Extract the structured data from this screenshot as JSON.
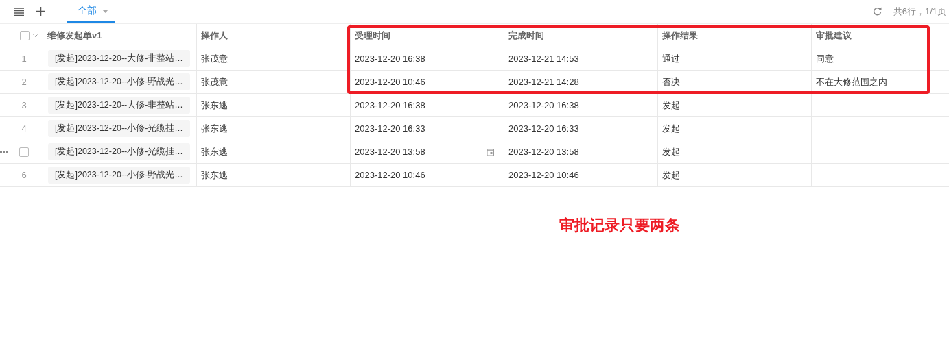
{
  "toolbar": {
    "tabs": [
      {
        "label": "全部",
        "selected": true
      }
    ],
    "summary": "共6行，1/1页"
  },
  "table": {
    "select_all_checked": false,
    "columns": [
      "维修发起单v1",
      "操作人",
      "受理时间",
      "完成时间",
      "操作结果",
      "审批建议"
    ],
    "rows": [
      {
        "index": "1",
        "hovered": false,
        "cells": [
          "[发起]2023-12-20--大修-非整站…",
          "张茂意",
          "2023-12-20 16:38",
          "2023-12-21 14:53",
          "通过",
          "同意"
        ]
      },
      {
        "index": "2",
        "hovered": false,
        "cells": [
          "[发起]2023-12-20--小修-野战光…",
          "张茂意",
          "2023-12-20 10:46",
          "2023-12-21 14:28",
          "否决",
          "不在大修范围之内"
        ]
      },
      {
        "index": "3",
        "hovered": false,
        "cells": [
          "[发起]2023-12-20--大修-非整站…",
          "张东逃",
          "2023-12-20 16:38",
          "2023-12-20 16:38",
          "发起"
        ]
      },
      {
        "index": "4",
        "hovered": false,
        "cells": [
          "[发起]2023-12-20--小修-光缆挂…",
          "张东逃",
          "2023-12-20 16:33",
          "2023-12-20 16:33",
          "发起"
        ]
      },
      {
        "hovered": true,
        "checked": false,
        "cells": [
          "[发起]2023-12-20--小修-光缆挂…",
          "张东逃",
          "2023-12-20 13:58",
          "2023-12-20 13:58",
          "发起"
        ]
      },
      {
        "index": "6",
        "hovered": false,
        "cells": [
          "[发起]2023-12-20--小修-野战光…",
          "张东逃",
          "2023-12-20 10:46",
          "2023-12-20 10:46",
          "发起"
        ]
      }
    ]
  },
  "annotation": {
    "text": "审批记录只要两条"
  }
}
